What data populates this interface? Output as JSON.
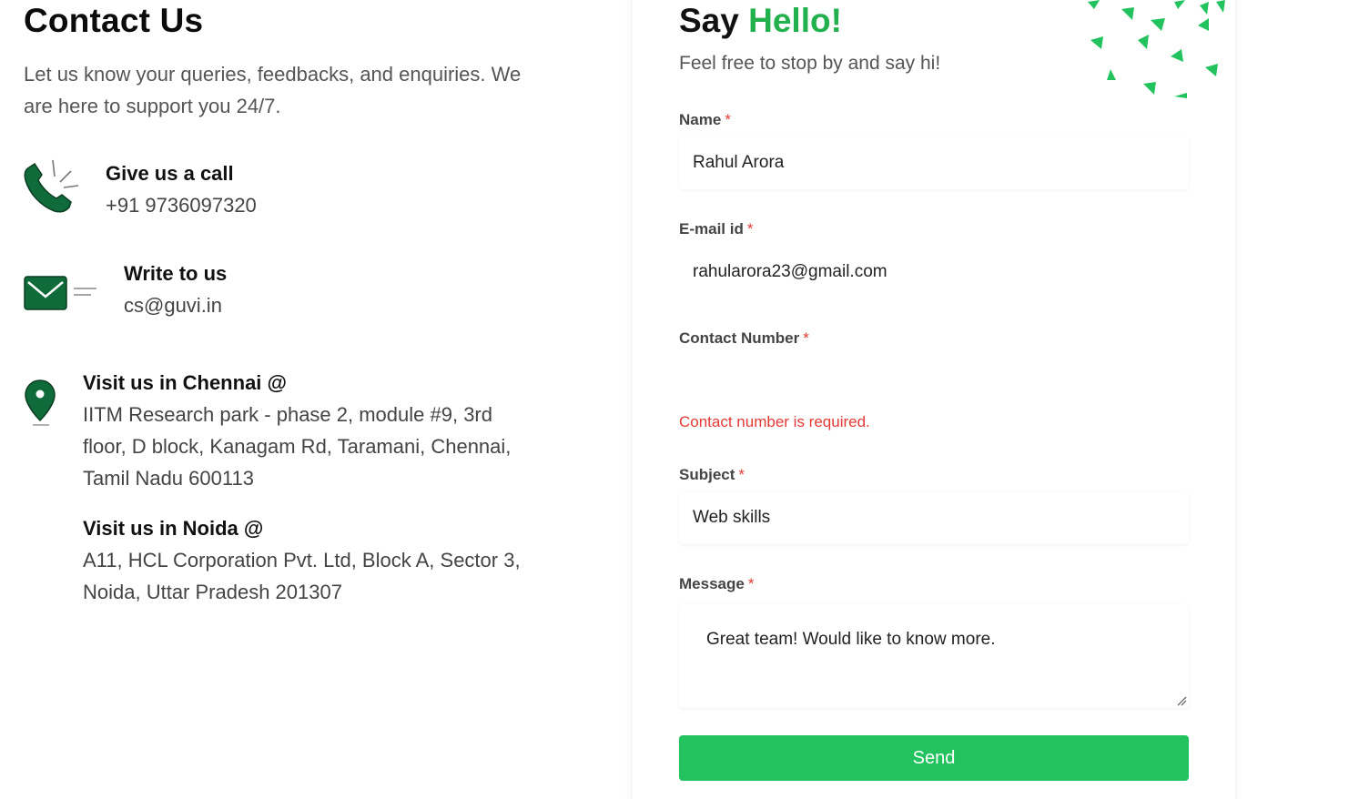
{
  "contact": {
    "title": "Contact Us",
    "intro": "Let us know your queries, feedbacks, and enquiries. We are here to support you 24/7."
  },
  "call": {
    "heading": "Give us a call",
    "phone": "+91 9736097320",
    "icon": "phone-icon"
  },
  "write": {
    "heading": "Write to us",
    "email": "cs@guvi.in",
    "icon": "mail-icon"
  },
  "chennai": {
    "heading": "Visit us in Chennai @",
    "address": "IITM Research park - phase 2, module #9, 3rd floor, D block, Kanagam Rd, Taramani, Chennai, Tamil Nadu 600113",
    "icon": "location-pin-icon"
  },
  "noida": {
    "heading": "Visit us in Noida @",
    "address": "A11, HCL Corporation Pvt. Ltd, Block A, Sector 3, Noida, Uttar Pradesh 201307"
  },
  "form": {
    "title_prefix": "Say",
    "title_highlight": "Hello!",
    "subtitle": "Feel free to stop by and say hi!",
    "required_mark": "*",
    "name_label": "Name",
    "name_value": "Rahul Arora",
    "email_label": "E-mail id",
    "email_value": "rahularora23@gmail.com",
    "contact_label": "Contact Number",
    "contact_value": "",
    "contact_error": "Contact number is required.",
    "subject_label": "Subject",
    "subject_value": "Web skills",
    "message_label": "Message",
    "message_value": "Great team! Would like to know more.",
    "send_label": "Send"
  },
  "colors": {
    "accent_green": "#22b14c",
    "button_green": "#22c35e",
    "icon_green": "#0f6b3a",
    "error_red": "#e53935"
  }
}
